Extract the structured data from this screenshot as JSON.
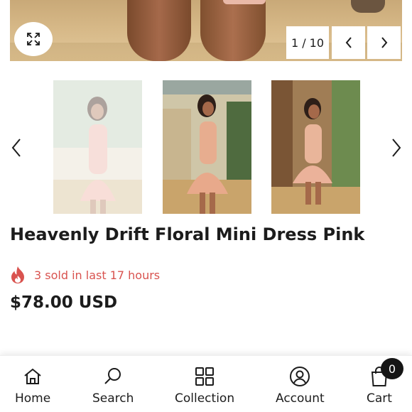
{
  "gallery": {
    "counter": "1 / 10",
    "zoom_icon": "expand-icon",
    "prev_icon": "chevron-left-icon",
    "next_icon": "chevron-right-icon",
    "thumbnails": [
      "thumbnail-1",
      "thumbnail-2",
      "thumbnail-3"
    ]
  },
  "product": {
    "title": "Heavenly Drift Floral Mini Dress Pink",
    "sold_text": "3 sold in last 17 hours",
    "price": "$78.00 USD"
  },
  "bottom_nav": {
    "items": [
      {
        "label": "Home",
        "icon": "home-icon"
      },
      {
        "label": "Search",
        "icon": "search-icon"
      },
      {
        "label": "Collection",
        "icon": "grid-icon"
      },
      {
        "label": "Account",
        "icon": "account-icon"
      },
      {
        "label": "Cart",
        "icon": "bag-icon"
      }
    ],
    "cart_count": "0"
  },
  "colors": {
    "accent_red": "#d9534f",
    "text": "#1c1c1c",
    "badge": "#151515"
  }
}
